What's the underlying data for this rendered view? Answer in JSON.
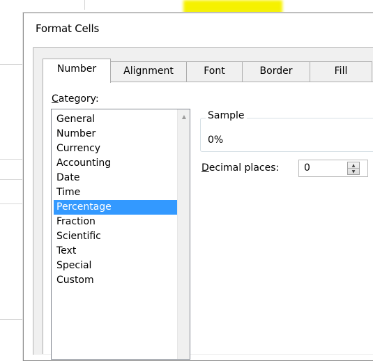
{
  "dialog": {
    "title": "Format Cells"
  },
  "tabs": [
    {
      "label": "Number",
      "active": true
    },
    {
      "label": "Alignment",
      "active": false
    },
    {
      "label": "Font",
      "active": false
    },
    {
      "label": "Border",
      "active": false
    },
    {
      "label": "Fill",
      "active": false
    }
  ],
  "category": {
    "label_accel": "C",
    "label_rest": "ategory:",
    "items": [
      "General",
      "Number",
      "Currency",
      "Accounting",
      "Date",
      "Time",
      "Percentage",
      "Fraction",
      "Scientific",
      "Text",
      "Special",
      "Custom"
    ],
    "selected": "Percentage",
    "scroll_up_icon": "triangle-up-icon"
  },
  "sample": {
    "legend": "Sample",
    "value": "0%"
  },
  "decimal_places": {
    "label_accel": "D",
    "label_rest": "ecimal places:",
    "value": "0"
  },
  "colors": {
    "selection": "#3399ff",
    "highlight": "#f5f100"
  }
}
